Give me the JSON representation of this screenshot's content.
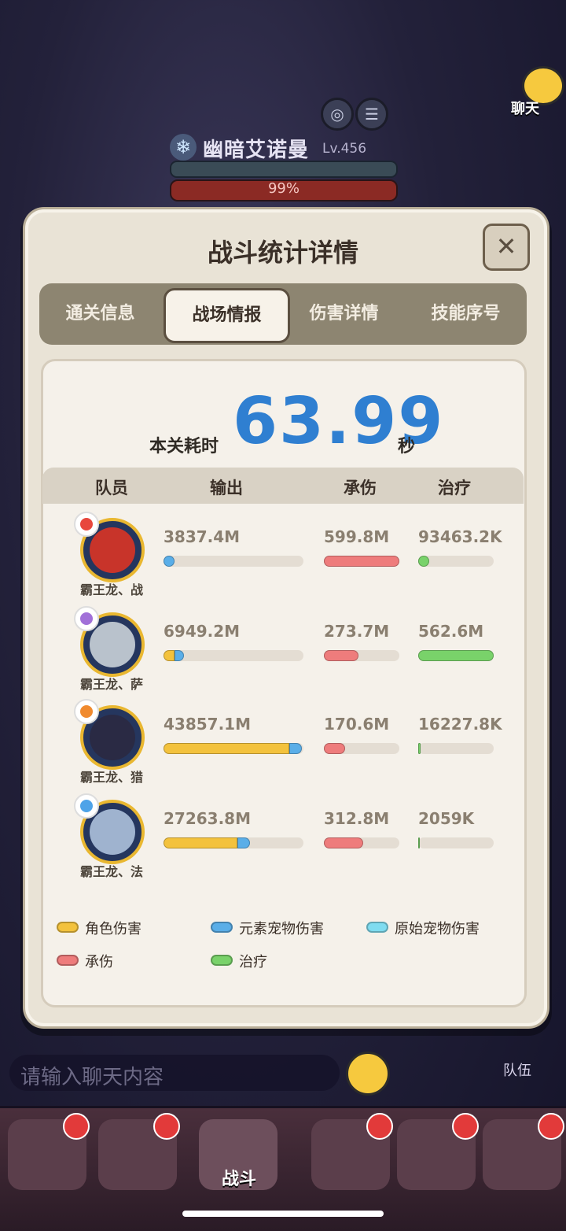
{
  "boss": {
    "name": "幽暗艾诺曼",
    "level": "Lv.456",
    "rage_text": "99%"
  },
  "chat": {
    "label": "聊天",
    "placeholder": "请输入聊天内容"
  },
  "side": {
    "team_label": "队伍"
  },
  "bottom_nav": {
    "battle_label": "战斗",
    "badge_count": 6
  },
  "panel": {
    "title": "战斗统计详情",
    "close_icon": "close-icon",
    "tabs": [
      {
        "label": "通关信息",
        "active": false
      },
      {
        "label": "战场情报",
        "active": true
      },
      {
        "label": "伤害详情",
        "active": false
      },
      {
        "label": "技能序号",
        "active": false
      }
    ],
    "time_label": "本关耗时",
    "time_value": "63.99",
    "time_unit": "秒",
    "headers": {
      "member": "队员",
      "output": "输出",
      "taken": "承伤",
      "heal": "治疗"
    },
    "members": [
      {
        "name": "霸王龙、战",
        "element_color": "#e8473d",
        "avatar_color": "#c8342a",
        "output": "3837.4M",
        "taken": "599.8M",
        "heal": "93463.2K",
        "output_role": 0.0,
        "output_element": 0.08,
        "taken_frac": 1.0,
        "heal_frac": 0.15
      },
      {
        "name": "霸王龙、萨",
        "element_color": "#a170d8",
        "avatar_color": "#b9c2cc",
        "output": "6949.2M",
        "taken": "273.7M",
        "heal": "562.6M",
        "output_role": 0.08,
        "output_element": 0.07,
        "taken_frac": 0.46,
        "heal_frac": 1.0
      },
      {
        "name": "霸王龙、猎",
        "element_color": "#f08a2e",
        "avatar_color": "#2a2a44",
        "output": "43857.1M",
        "taken": "170.6M",
        "heal": "16227.8K",
        "output_role": 0.9,
        "output_element": 0.09,
        "taken_frac": 0.28,
        "heal_frac": 0.03
      },
      {
        "name": "霸王龙、法",
        "element_color": "#4ea3e8",
        "avatar_color": "#9fb3cf",
        "output": "27263.8M",
        "taken": "312.8M",
        "heal": "2059K",
        "output_role": 0.53,
        "output_element": 0.09,
        "taken_frac": 0.52,
        "heal_frac": 0.01
      }
    ],
    "legend": [
      {
        "label": "角色伤害",
        "color": "#f3c23d"
      },
      {
        "label": "元素宠物伤害",
        "color": "#5aaee8"
      },
      {
        "label": "原始宠物伤害",
        "color": "#7fdcf0"
      },
      {
        "label": "承伤",
        "color": "#ee7c7c"
      },
      {
        "label": "治疗",
        "color": "#79d26a"
      }
    ]
  }
}
